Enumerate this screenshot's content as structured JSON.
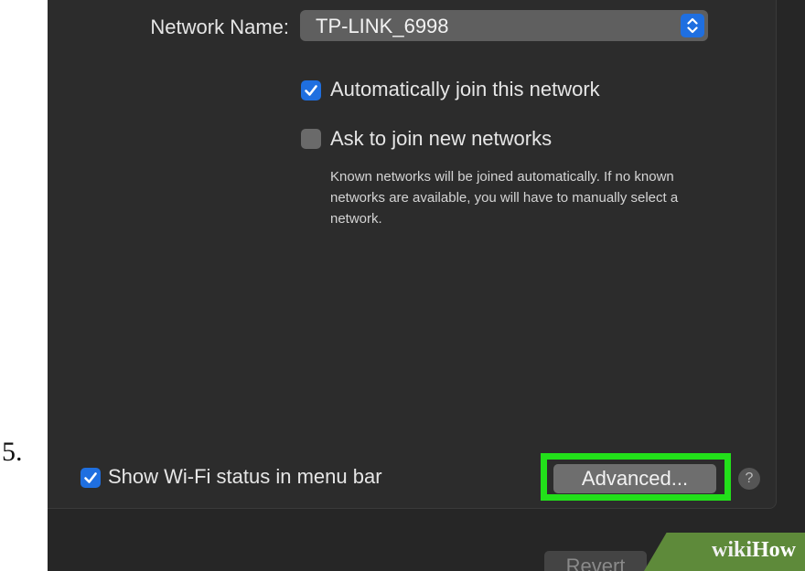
{
  "step_number": "5.",
  "network": {
    "label": "Network Name:",
    "selected_value": "TP-LINK_6998",
    "stepper_icon": "up-down-chevron-icon"
  },
  "options": {
    "auto_join": {
      "label": "Automatically join this network",
      "checked": true
    },
    "ask_join": {
      "label": "Ask to join new networks",
      "checked": false,
      "help_text": "Known networks will be joined automatically. If no known networks are available, you will have to manually select a network."
    }
  },
  "footer": {
    "show_wifi_status": {
      "label": "Show Wi-Fi status in menu bar",
      "checked": true
    },
    "advanced_button": "Advanced...",
    "help_button": "?",
    "revert_button": "Revert"
  },
  "watermark": {
    "part1": "wiki",
    "part2": "How"
  },
  "colors": {
    "accent": "#1f6fe0",
    "highlight": "#22e01a",
    "panel_background": "#2c2c2c",
    "watermark_green": "#5e8a3a"
  }
}
